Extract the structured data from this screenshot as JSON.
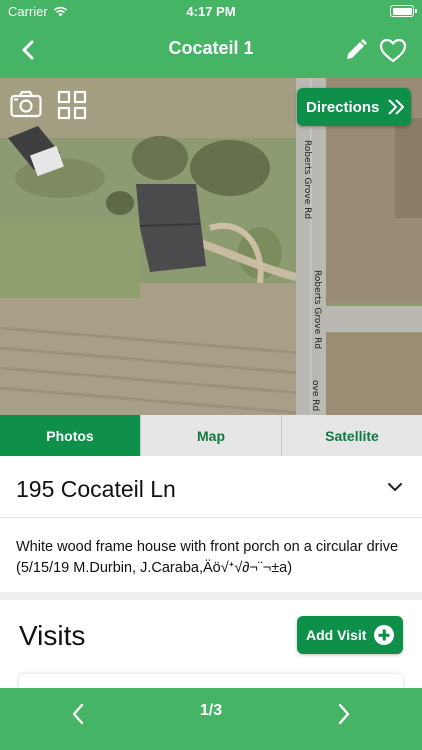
{
  "status_bar": {
    "carrier": "Carrier",
    "time": "4:17 PM"
  },
  "nav": {
    "title": "Cocateil 1",
    "back_icon": "chevron-left-icon",
    "edit_icon": "pencil-icon",
    "favorite_icon": "heart-outline-icon"
  },
  "map": {
    "camera_icon": "camera-icon",
    "gallery_icon": "grid-icon",
    "directions_label": "Directions",
    "directions_icon": "double-chevron-right-icon",
    "road_labels": [
      "Roberts Grove Rd",
      "Roberts Grove Rd",
      "ove Rd",
      "Roberts G"
    ]
  },
  "tabs": [
    {
      "label": "Photos",
      "active": true
    },
    {
      "label": "Map",
      "active": false
    },
    {
      "label": "Satellite",
      "active": false
    }
  ],
  "place": {
    "address": "195 Cocateil Ln",
    "description": "White wood frame house with front porch on a circular drive (5/15/19 M.Durbin, J.Caraba,Äö√ᐩ√∂¬¨¬±a)"
  },
  "visits": {
    "title": "Visits",
    "add_label": "Add Visit"
  },
  "pager": {
    "count": "1/3"
  },
  "colors": {
    "header_green": "#45b565",
    "button_green": "#0e8f4a",
    "tab_inactive": "#e6e6e6"
  }
}
